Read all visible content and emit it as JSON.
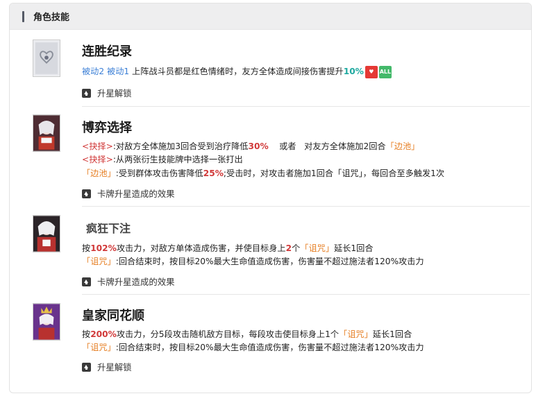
{
  "panel": {
    "title": "角色技能"
  },
  "skills": [
    {
      "name": "连胜纪录",
      "line1": {
        "passive1": "被动2",
        "passive2": "被动1",
        "text": "上阵战斗员都是红色情绪时，友方全体造成间接伤害提升",
        "value": "10%",
        "badge1": "heart-shield-icon",
        "badge2": "ALL"
      },
      "footer": "升星解锁"
    },
    {
      "name": "博弈选择",
      "line1": {
        "tag": "<抉择>",
        "a": ":对敌方全体施加3回合受到治疗降低",
        "v": "30%",
        "b": "或者",
        "c": "对友方全体施加2回合",
        "tag2": "「边池」"
      },
      "line2": {
        "tag": "<抉择>",
        "a": ":从两张衍生技能牌中选择一张打出"
      },
      "line3": {
        "tag": "「边池」",
        "a": ":受到群体攻击伤害降低",
        "v": "25%",
        "b": ";受击时，对攻击者施加1回合「诅咒」，每回合至多触发1次"
      },
      "footer": "卡牌升星造成的效果"
    },
    {
      "name": "疯狂下注",
      "line1": {
        "a": "按",
        "v": "102%",
        "b": "攻击力，对敌方单体造成伤害，并使目标身上",
        "v2": "2",
        "c": "个",
        "tag": "「诅咒」",
        "d": "延长1回合"
      },
      "line2": {
        "tag": "「诅咒」",
        "a": ":回合结束时，按目标20%最大生命值造成伤害，伤害量不超过施法者120%攻击力"
      },
      "footer": "卡牌升星造成的效果"
    },
    {
      "name": "皇家同花顺",
      "line1": {
        "a": "按",
        "v": "200%",
        "b": "攻击力，分5段攻击随机敌方目标，每段攻击使目标身上1个",
        "tag": "「诅咒」",
        "c": "延长1回合"
      },
      "line2": {
        "tag": "「诅咒」",
        "a": ":回合结束时，按目标20%最大生命值造成伤害，伤害量不超过施法者120%攻击力"
      },
      "footer": "升星解锁"
    }
  ],
  "colors": {
    "accent_red": "#d13a3a",
    "accent_orange": "#e67e22",
    "accent_teal": "#1fa9a0",
    "link_blue": "#3b7fd6"
  }
}
